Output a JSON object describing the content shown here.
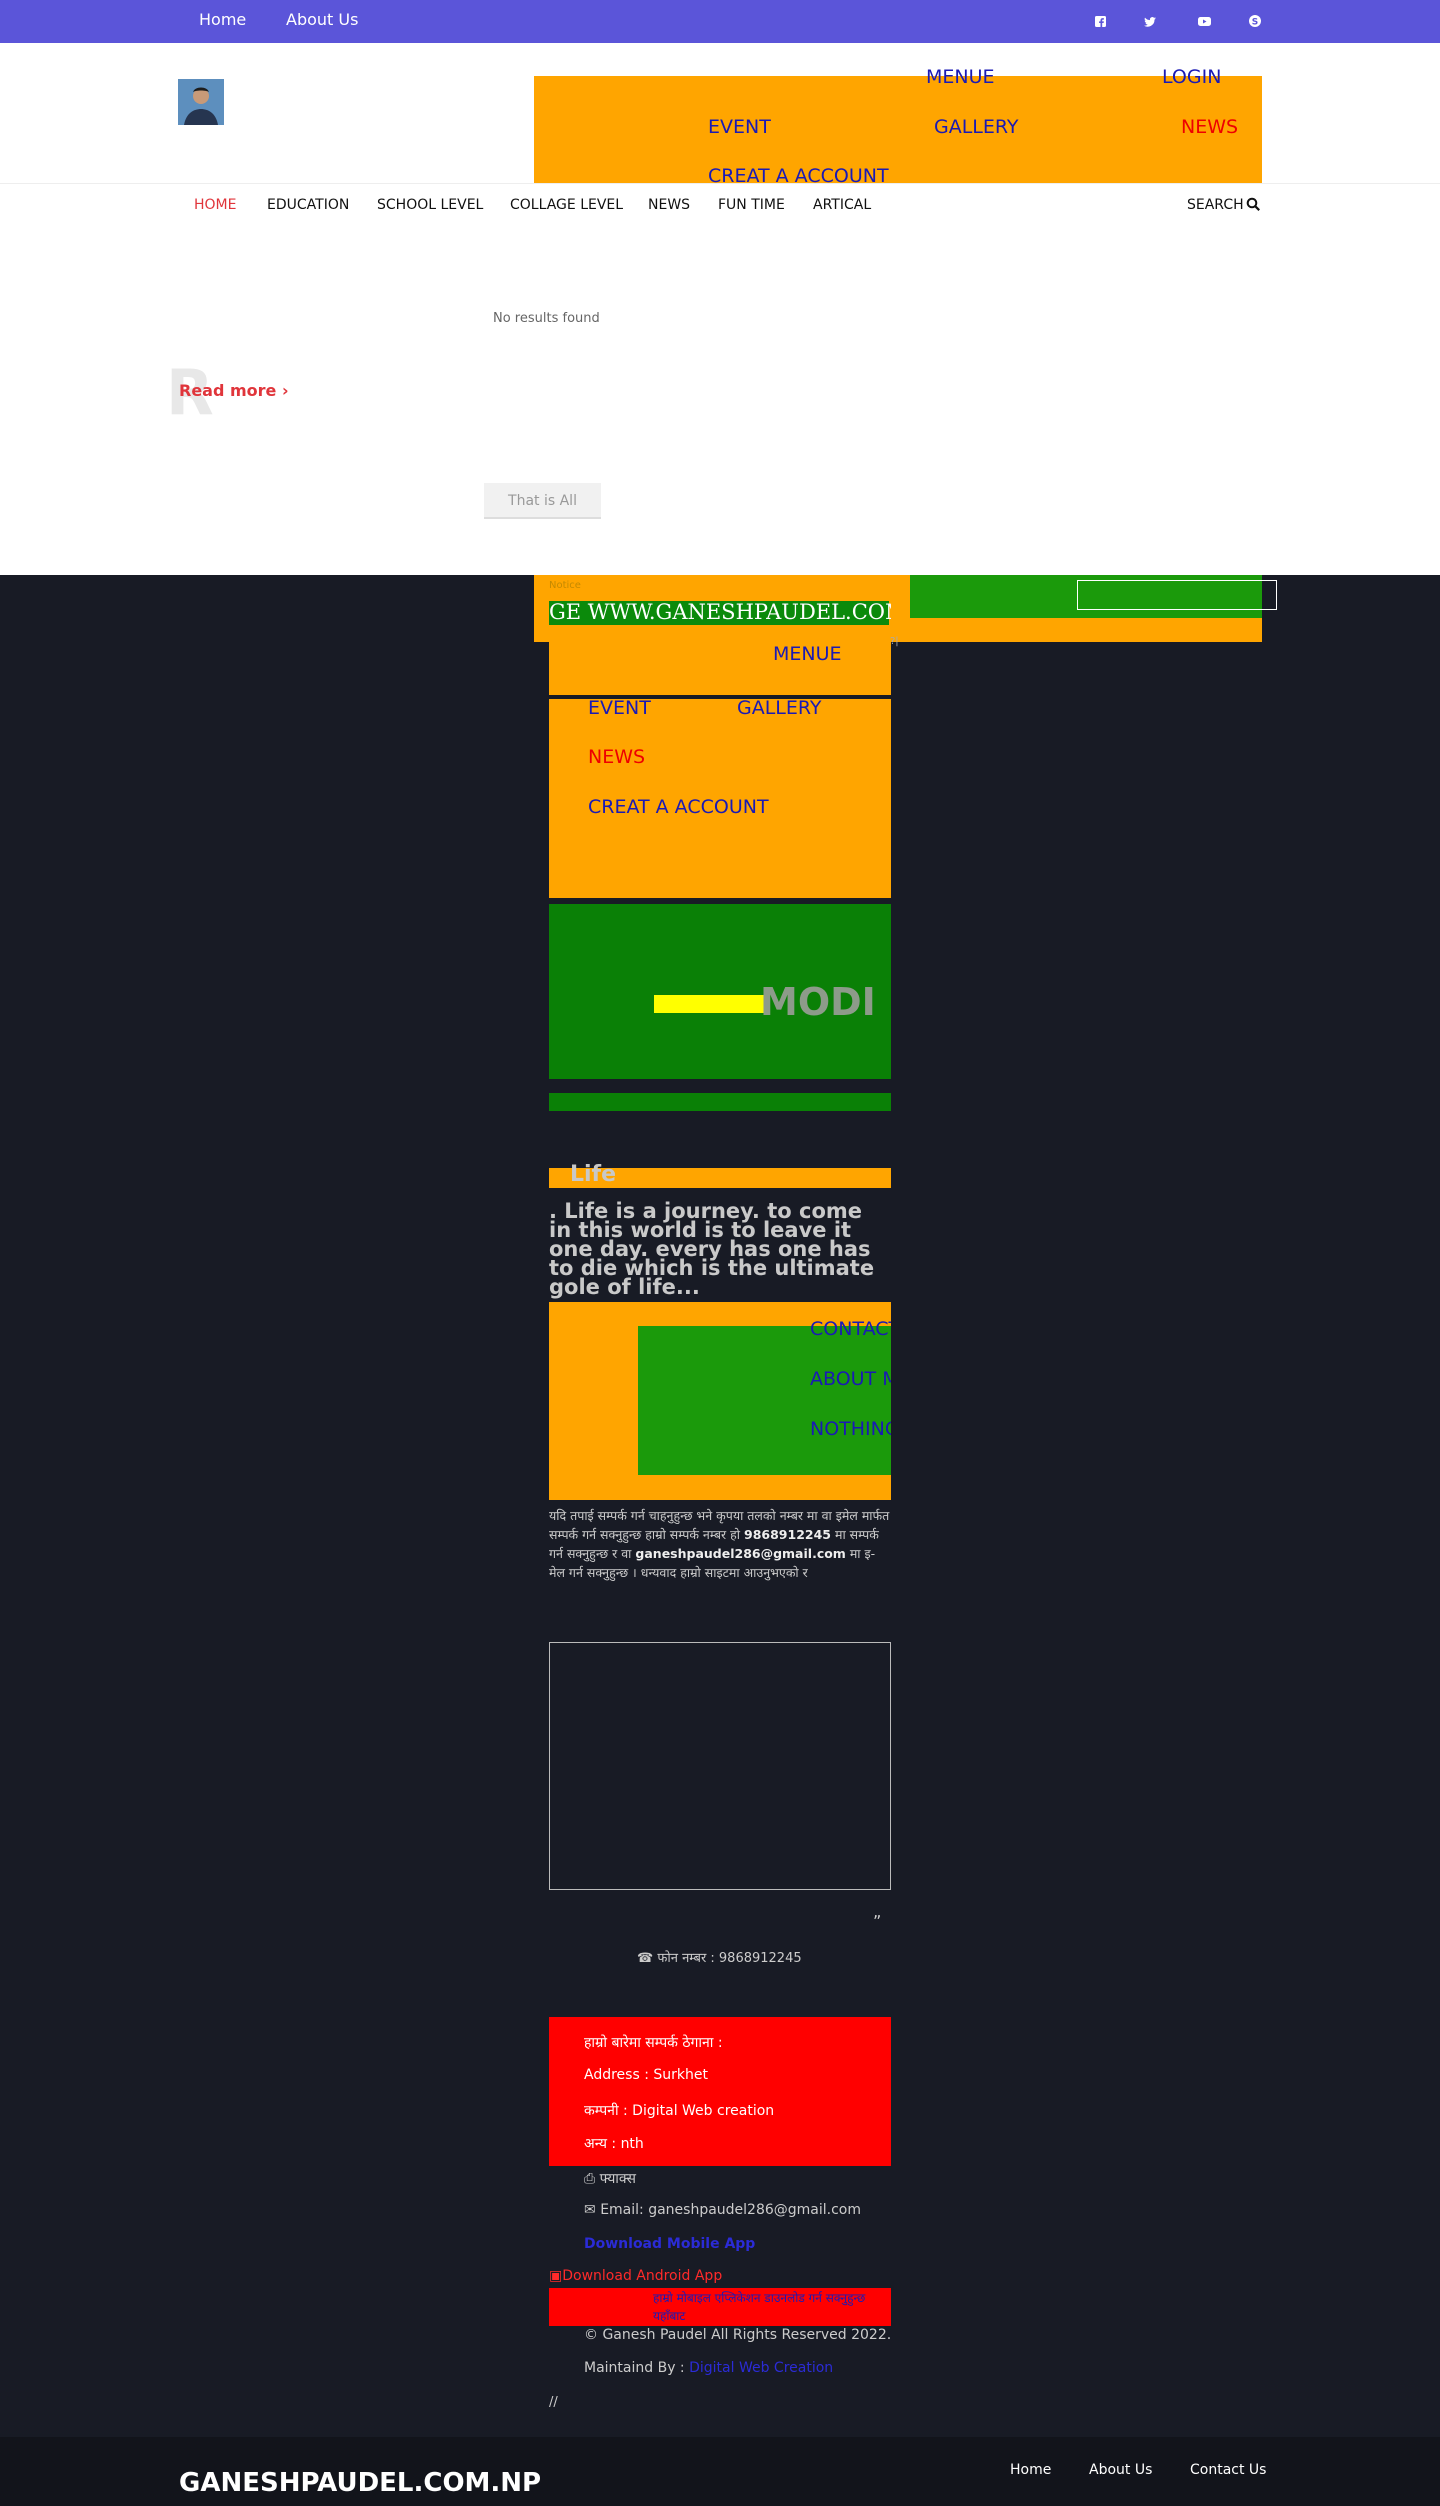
{
  "topbar": {
    "links": [
      "Home",
      "About Us"
    ],
    "social_icons": [
      "facebook-icon",
      "twitter-icon",
      "youtube-icon",
      "skype-icon"
    ]
  },
  "header": {
    "orange_menu": {
      "menue": "MENUE",
      "login": "LOGIN",
      "event": "EVENT",
      "gallery": "GALLERY",
      "news": "NEWS",
      "create_account": "CREAT A ACCOUNT"
    },
    "main_nav": [
      "HOME",
      "EDUCATION",
      "SCHOOL LEVEL",
      "COLLAGE LEVEL",
      "NEWS",
      "FUN TIME",
      "ARTICAL"
    ],
    "search_label": "SEARCH"
  },
  "main": {
    "no_results": "No results found",
    "big_letter": "R",
    "read_more": "Read more",
    "that_is_all": "That is All"
  },
  "dark": {
    "marquee_label": "Notice",
    "marquee_text": "GE WWW.GANESHPAUDEL.COM.NP",
    "tiny_mark": "?|",
    "menu": {
      "menue": "MENUE",
      "event": "EVENT",
      "gallery": "GALLERY",
      "news": "NEWS",
      "create_account": "CREAT A ACCOUNT"
    },
    "modi": "MODI",
    "life_word": "Life",
    "quote": ". Life is a journey. to come in this world is to leave it one day. every has one has to die which is the ultimate gole of life...",
    "contact_links": [
      "CONTACT",
      "ABOUT ME",
      "NOTHING"
    ],
    "np_text_1": "यदि तपाई सम्पर्क गर्न चाहनुहुन्छ भने कृपया तलको नम्बर मा वा इमेल मार्फत सम्पर्क गर्न सक्नुहुन्छ हाम्रो सम्पर्क नम्बर हो",
    "np_phone": "9868912245",
    "np_text_2": "मा सम्पर्क गर्न सक्नुहुन्छ र वा",
    "np_email": "ganeshpaudel286@gmail.com",
    "np_text_3": "मा इ-मेल गर्न सक्नुहुन्छ । धन्यवाद हाम्रो साइटमा आउनुभएको र",
    "quote_mark": "„",
    "phone_line": "फोन नम्बर : 9868912245"
  },
  "contact_red": {
    "heading": "हाम्रो बारेमा सम्पर्क ठेगाना :",
    "address": "Address : Surkhet",
    "company": "कम्पनी : Digital Web creation",
    "other": "अन्य : nth"
  },
  "contact_more": {
    "fax": "फ्याक्स",
    "email": "Email: ganeshpaudel286@gmail.com",
    "download_mobile": "Download Mobile App",
    "download_android": "Download Android App",
    "red_bar_text": "हाम्रो मोबाइल एप्लिकेशन डाउनलोड गर्न सक्नुहुन्छ यहाँबाट",
    "copyright": "© Ganesh Paudel All Rights Reserved 2022.",
    "maintained_label": "Maintaind By :",
    "maintained_link": "Digital Web Creation",
    "slashes": "//"
  },
  "footer": {
    "brand": "GANESHPAUDEL.COM.NP",
    "links": [
      "Home",
      "About Us",
      "Contact Us"
    ]
  },
  "colors": {
    "topbar": "#5b55d9",
    "orange": "#ffa500",
    "green": "#0a8006",
    "red": "#ff0000",
    "accent_red": "#e0353b",
    "dark_bg": "#181b25"
  }
}
